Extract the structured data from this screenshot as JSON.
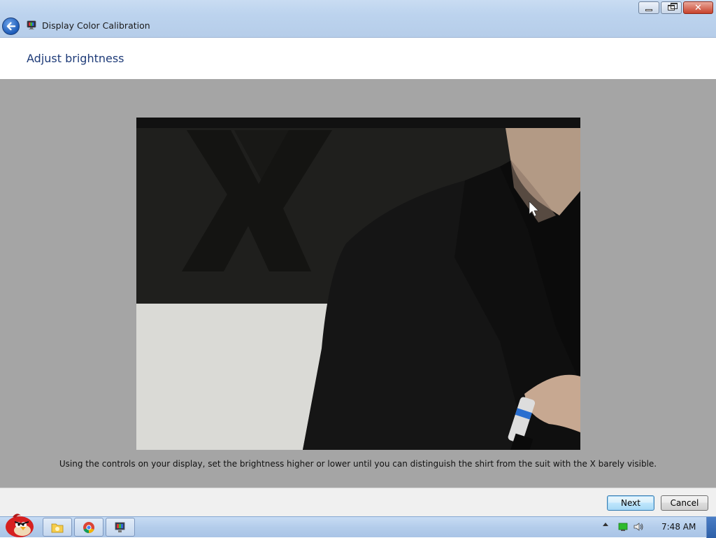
{
  "window": {
    "title": "Display Color Calibration",
    "controls": {
      "minimize": "minimize",
      "restore": "restore",
      "close": "close"
    }
  },
  "header": {
    "page_title": "Adjust brightness"
  },
  "main": {
    "instruction": "Using the controls on your display, set the brightness higher or lower until you can distinguish the shirt from the suit with the X barely visible."
  },
  "footer": {
    "next_label": "Next",
    "cancel_label": "Cancel"
  },
  "taskbar": {
    "start_icon": "angry-bird-start-icon",
    "pinned": [
      "folder-icon",
      "chrome-icon",
      "display-calibration-icon"
    ],
    "tray": [
      "show-hidden-icons",
      "network-icon",
      "volume-icon"
    ],
    "clock": "7:48 AM"
  },
  "colors": {
    "title_text": "#1e3b78",
    "content_bg": "#a5a5a5",
    "header_bg": "#ffffff"
  }
}
